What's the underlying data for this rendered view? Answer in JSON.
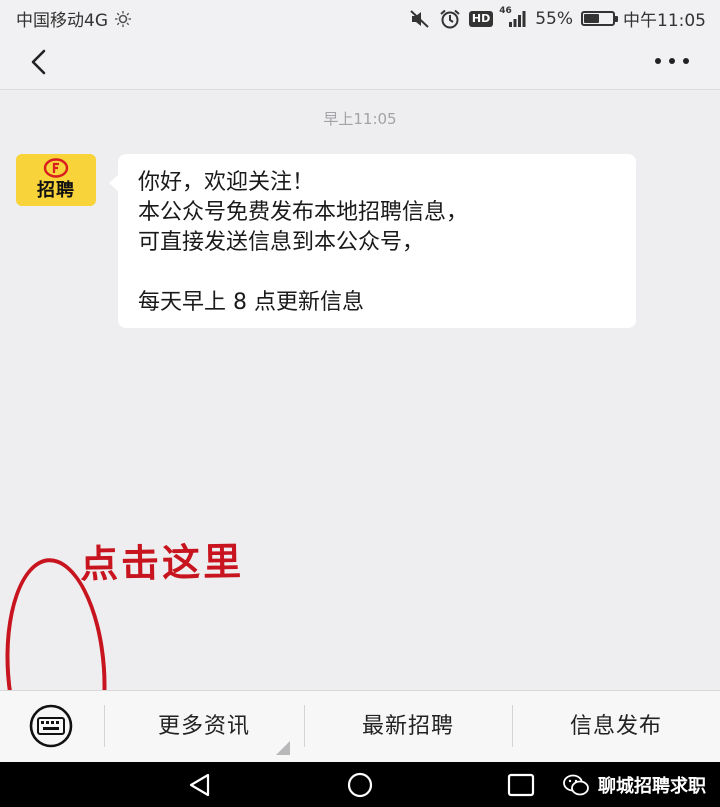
{
  "status_bar": {
    "carrier": "中国移动4G",
    "network": "46",
    "battery": "55%",
    "battery_level": 0.55,
    "time": "中午11:05",
    "hd_label": "HD"
  },
  "nav": {
    "back_icon": "chevron-left-icon",
    "more_icon": "more-dots-icon"
  },
  "chat": {
    "timestamp": "早上11:05",
    "avatar_label": "招聘",
    "message_lines": [
      "你好，欢迎关注！",
      "本公众号免费发布本地招聘信息，",
      "可直接发送信息到本公众号，",
      "每天早上 8 点更新信息"
    ]
  },
  "annotation": {
    "text": "点击这里",
    "color": "#c8141e"
  },
  "menu": {
    "items": [
      "更多资讯",
      "最新招聘",
      "信息发布"
    ],
    "keyboard_icon": "keyboard-icon"
  },
  "watermark": {
    "text": "聊城招聘求职"
  },
  "colors": {
    "background": "#eeedef",
    "avatar_yellow": "#f8d33a",
    "bubble": "#ffffff"
  }
}
